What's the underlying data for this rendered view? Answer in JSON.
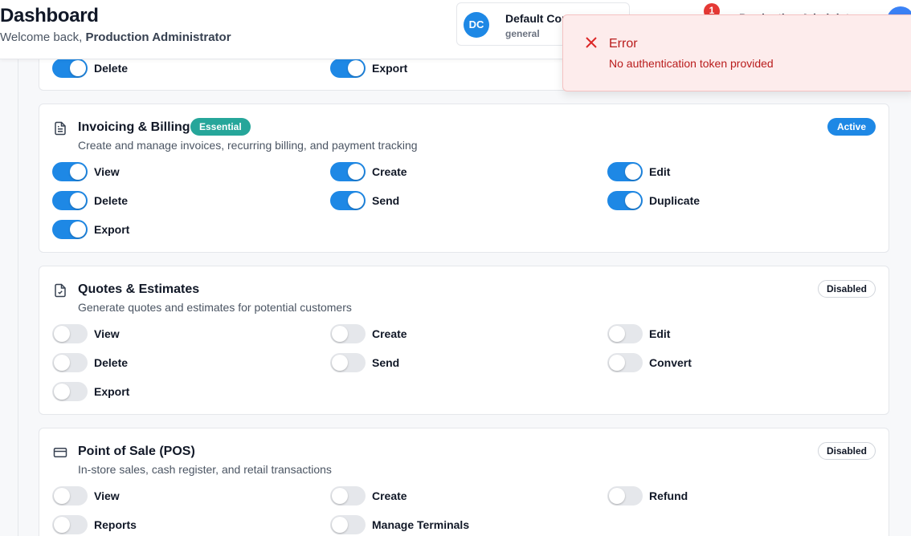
{
  "header": {
    "title": "Dashboard",
    "welcome_prefix": "Welcome back, ",
    "welcome_name": "Production Administrator",
    "company": {
      "initials": "DC",
      "name": "Default Con",
      "type": "general"
    },
    "notification_count": "1",
    "user_name": "Production Administ"
  },
  "toast": {
    "title": "Error",
    "message": "No authentication token provided"
  },
  "top_card": {
    "permissions": [
      {
        "label": "Delete",
        "on": true
      },
      {
        "label": "Export",
        "on": true
      }
    ]
  },
  "modules": [
    {
      "title": "Invoicing & Billing",
      "badge": "Essential",
      "status": "Active",
      "description": "Create and manage invoices, recurring billing, and payment tracking",
      "icon": "document-icon",
      "permissions": [
        {
          "label": "View",
          "on": true
        },
        {
          "label": "Create",
          "on": true
        },
        {
          "label": "Edit",
          "on": true
        },
        {
          "label": "Delete",
          "on": true
        },
        {
          "label": "Send",
          "on": true
        },
        {
          "label": "Duplicate",
          "on": true
        },
        {
          "label": "Export",
          "on": true
        }
      ]
    },
    {
      "title": "Quotes & Estimates",
      "status": "Disabled",
      "description": "Generate quotes and estimates for potential customers",
      "icon": "file-check-icon",
      "permissions": [
        {
          "label": "View",
          "on": false
        },
        {
          "label": "Create",
          "on": false
        },
        {
          "label": "Edit",
          "on": false
        },
        {
          "label": "Delete",
          "on": false
        },
        {
          "label": "Send",
          "on": false
        },
        {
          "label": "Convert",
          "on": false
        },
        {
          "label": "Export",
          "on": false
        }
      ]
    },
    {
      "title": "Point of Sale (POS)",
      "status": "Disabled",
      "description": "In-store sales, cash register, and retail transactions",
      "icon": "credit-card-icon",
      "permissions": [
        {
          "label": "View",
          "on": false
        },
        {
          "label": "Create",
          "on": false
        },
        {
          "label": "Refund",
          "on": false
        },
        {
          "label": "Reports",
          "on": false
        },
        {
          "label": "Manage Terminals",
          "on": false
        }
      ]
    }
  ],
  "colors": {
    "accent": "#1e88e5",
    "essential": "#26a69a",
    "error": "#b91c1c"
  }
}
